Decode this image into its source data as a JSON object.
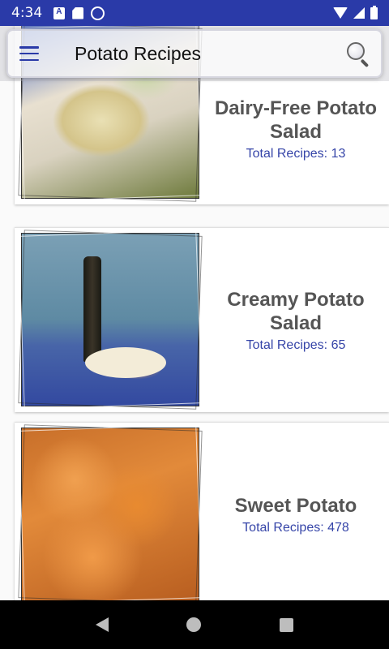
{
  "status_bar": {
    "time": "4:34",
    "left_icons": [
      "a-icon",
      "sd-card-icon",
      "circle-icon"
    ],
    "right_icons": [
      "wifi-icon",
      "signal-icon",
      "battery-icon"
    ],
    "background": "#2a3aa8"
  },
  "app_bar": {
    "title": "Potato Recipes",
    "menu_icon": "menu-icon",
    "search_icon": "search-icon"
  },
  "recipes": [
    {
      "title": "Dairy-Free Potato Salad",
      "count_label": "Total Recipes: 13",
      "image": "potato-salad-photo"
    },
    {
      "title": "Creamy Potato Salad",
      "count_label": "Total Recipes: 65",
      "image": "picnic-photo"
    },
    {
      "title": "Sweet Potato",
      "count_label": "Total Recipes: 478",
      "image": "sweet-potato-photo"
    }
  ],
  "nav_bar": {
    "back": "back-icon",
    "home": "home-icon",
    "recents": "recents-icon"
  },
  "colors": {
    "accent": "#3645a8",
    "title_text": "#555555"
  }
}
